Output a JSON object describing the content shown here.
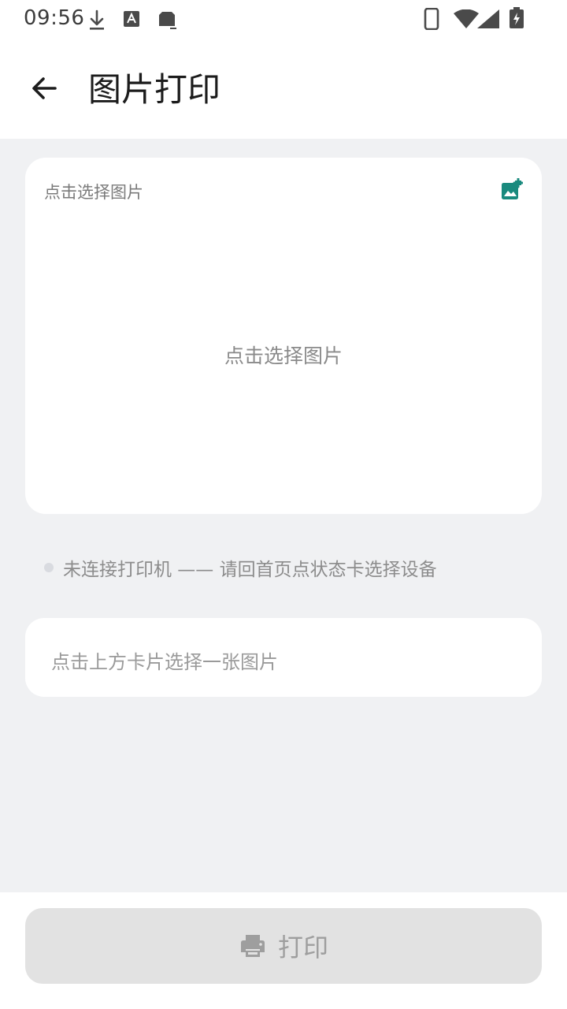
{
  "status_bar": {
    "time": "09:56",
    "icons": [
      "download-icon",
      "font-icon",
      "sd-card-icon",
      "phone-icon",
      "wifi-icon",
      "signal-icon",
      "battery-charging-icon"
    ]
  },
  "app_bar": {
    "back_icon": "arrow-back-icon",
    "title": "图片打印"
  },
  "picker_card": {
    "label": "点击选择图片",
    "add_icon": "add-photo-icon",
    "center_text": "点击选择图片"
  },
  "printer_status": {
    "text": "未连接打印机 —— 请回首页点状态卡选择设备",
    "dot_color": "#d9dbe0"
  },
  "hint_card": {
    "text": "点击上方卡片选择一张图片"
  },
  "print_button": {
    "icon": "printer-icon",
    "label": "打印",
    "enabled": false
  },
  "colors": {
    "accent": "#1a8a7e",
    "background": "#f0f1f3",
    "disabled_button": "#e2e2e2"
  }
}
